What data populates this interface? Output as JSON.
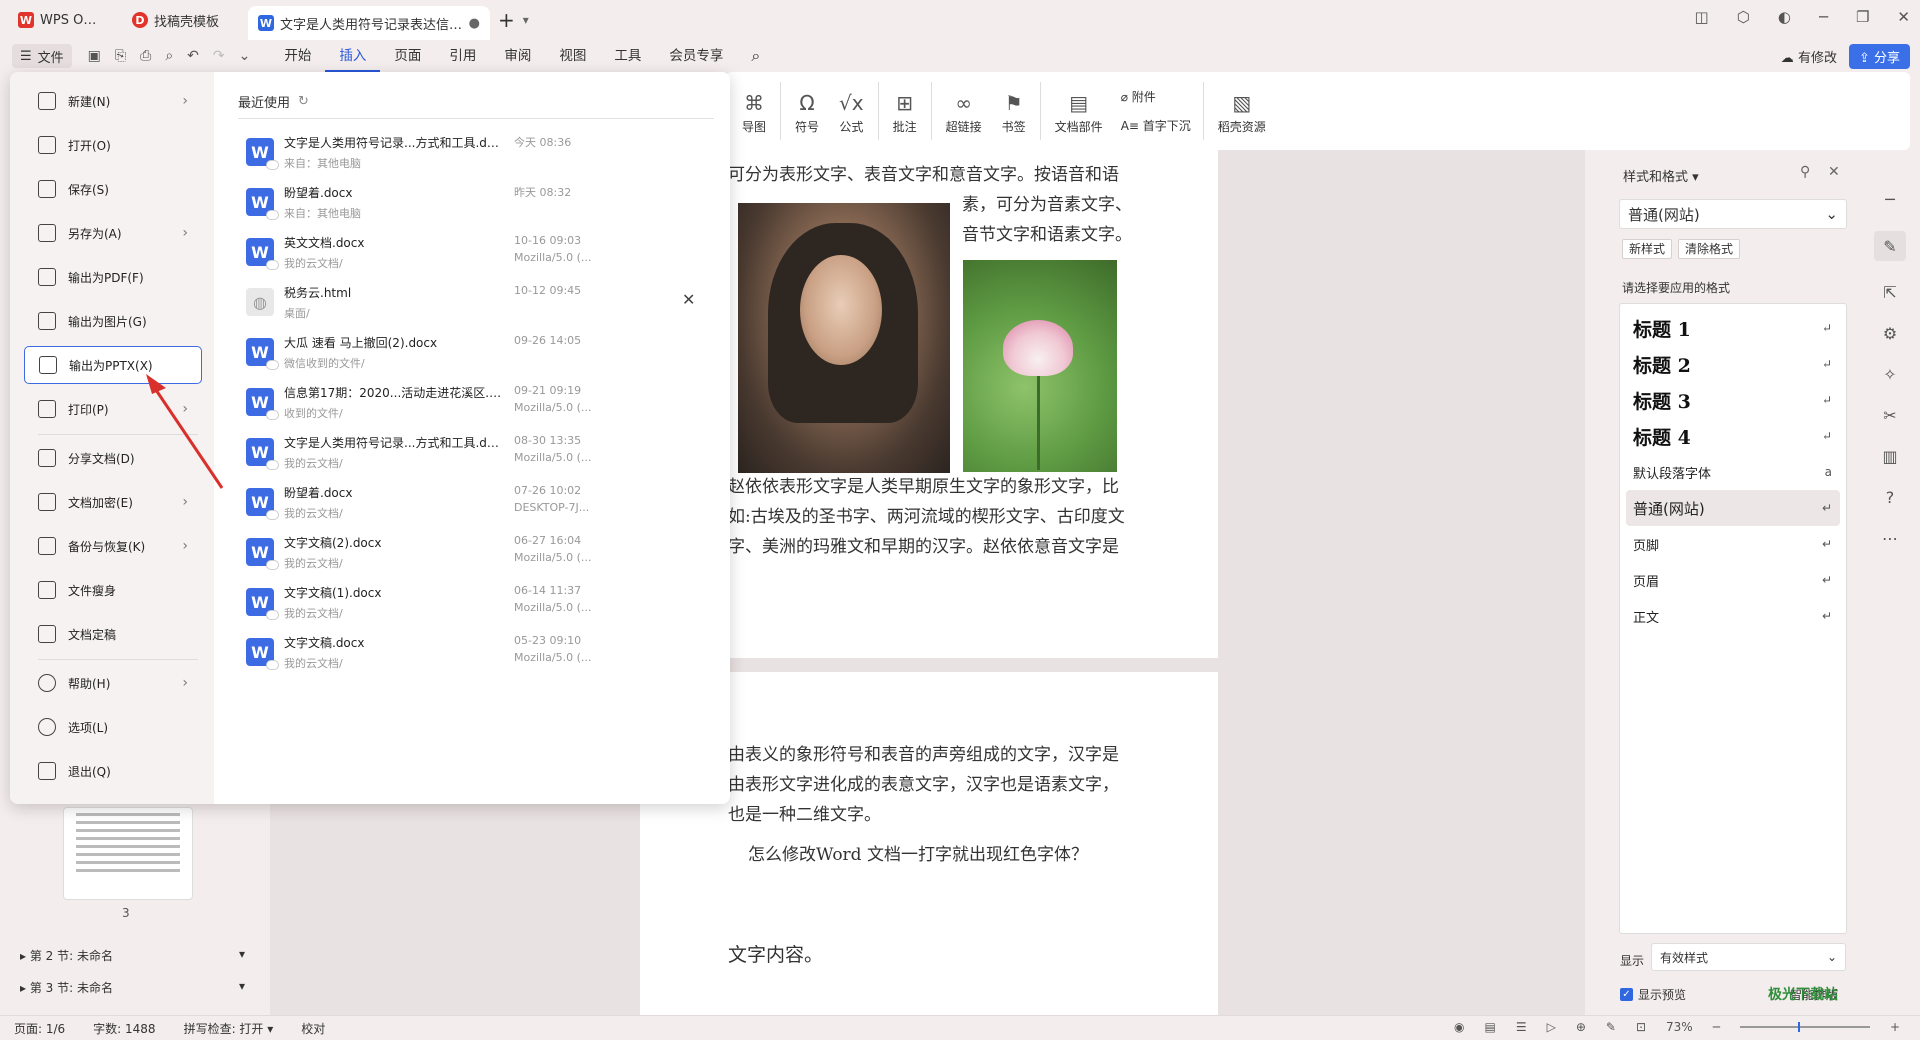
{
  "titlebar": {
    "tabs": [
      {
        "label": "WPS Office",
        "icon": "wps-logo"
      },
      {
        "label": "找稿壳模板",
        "icon": "docer-logo"
      },
      {
        "label": "文字是人类用符号记录表达信息以",
        "icon": "word-doc-icon"
      }
    ],
    "new_tab": "+"
  },
  "menubar": {
    "file": "文件",
    "items": [
      "开始",
      "插入",
      "页面",
      "引用",
      "审阅",
      "视图",
      "工具",
      "会员专享"
    ],
    "active": "插入",
    "modify": "有修改",
    "share": "分享"
  },
  "ribbon": {
    "items": [
      "导图",
      "符号",
      "公式",
      "批注",
      "超链接",
      "书签",
      "文档部件",
      "附件",
      "首字下沉",
      "稻壳资源"
    ]
  },
  "filemenu": {
    "items": [
      {
        "label": "新建(N)",
        "arrow": true
      },
      {
        "label": "打开(O)",
        "arrow": false
      },
      {
        "label": "保存(S)",
        "arrow": false
      },
      {
        "label": "另存为(A)",
        "arrow": true
      },
      {
        "label": "输出为PDF(F)",
        "arrow": false
      },
      {
        "label": "输出为图片(G)",
        "arrow": false
      },
      {
        "label": "输出为PPTX(X)",
        "arrow": false
      },
      {
        "label": "打印(P)",
        "arrow": true
      },
      {
        "label": "分享文档(D)",
        "arrow": false
      },
      {
        "label": "文档加密(E)",
        "arrow": true
      },
      {
        "label": "备份与恢复(K)",
        "arrow": true
      },
      {
        "label": "文件瘦身",
        "arrow": false
      },
      {
        "label": "文档定稿",
        "arrow": false
      },
      {
        "label": "帮助(H)",
        "arrow": true
      },
      {
        "label": "选项(L)",
        "arrow": false
      },
      {
        "label": "退出(Q)",
        "arrow": false
      }
    ],
    "recent_title": "最近使用",
    "recent": [
      {
        "name": "文字是人类用符号记录...方式和工具.docx",
        "loc": "来自：其他电脑",
        "time": "今天 08:36",
        "ua": "",
        "type": "W"
      },
      {
        "name": "盼望着.docx",
        "loc": "来自：其他电脑",
        "time": "昨天 08:32",
        "ua": "",
        "type": "W"
      },
      {
        "name": "英文文档.docx",
        "loc": "我的云文档/",
        "time": "10-16 09:03",
        "ua": "Mozilla/5.0 (...",
        "type": "W"
      },
      {
        "name": "税务云.html",
        "loc": "桌面/",
        "time": "10-12 09:45",
        "ua": "",
        "type": "html"
      },
      {
        "name": "大瓜 速看 马上撤回(2).docx",
        "loc": "微信收到的文件/",
        "time": "09-26 14:05",
        "ua": "",
        "type": "W"
      },
      {
        "name": "信息第17期：2020...活动走进花溪区.doc",
        "loc": "收到的文件/",
        "time": "09-21 09:19",
        "ua": "Mozilla/5.0 (...",
        "type": "W"
      },
      {
        "name": "文字是人类用符号记录...方式和工具.docx",
        "loc": "我的云文档/",
        "time": "08-30 13:35",
        "ua": "Mozilla/5.0 (...",
        "type": "W"
      },
      {
        "name": "盼望着.docx",
        "loc": "我的云文档/",
        "time": "07-26 10:02",
        "ua": "DESKTOP-7J...",
        "type": "W"
      },
      {
        "name": "文字文稿(2).docx",
        "loc": "我的云文档/",
        "time": "06-27 16:04",
        "ua": "Mozilla/5.0 (...",
        "type": "W"
      },
      {
        "name": "文字文稿(1).docx",
        "loc": "我的云文档/",
        "time": "06-14 11:37",
        "ua": "Mozilla/5.0 (...",
        "type": "W"
      },
      {
        "name": "文字文稿.docx",
        "loc": "我的云文档/",
        "time": "05-23 09:10",
        "ua": "Mozilla/5.0 (...",
        "type": "W"
      }
    ]
  },
  "document": {
    "page1": [
      "可分为表形文字、表音文字和意音文字。按语音和语",
      "素，可分为音素文字、",
      "音节文字和语素文字。",
      "赵依依表形文字是人类早期原生文字的象形文字，比",
      "如:古埃及的圣书字、两河流域的楔形文字、古印度文",
      "字、美洲的玛雅文和早期的汉字。赵依依意音文字是"
    ],
    "page2": [
      "由表义的象形符号和表音的声旁组成的文字，汉字是",
      "由表形文字进化成的表意文字，汉字也是语素文字，",
      "也是一种二维文字。",
      "怎么修改Word 文档一打字就出现红色字体？",
      "文字内容。"
    ]
  },
  "navpanel": {
    "thumb_num": "3",
    "sections": [
      "第 2 节: 未命名",
      "第 3 节: 未命名"
    ]
  },
  "stylepanel": {
    "title": "样式和格式",
    "current": "普通(网站)",
    "new_style": "新样式",
    "clear_format": "清除格式",
    "label": "请选择要应用的格式",
    "styles": [
      "标题 1",
      "标题 2",
      "标题 3",
      "标题 4",
      "默认段落字体",
      "普通(网站)",
      "页脚",
      "页眉",
      "正文"
    ],
    "show_label": "显示",
    "show_value": "有效样式",
    "preview": "显示预览",
    "smart": "智能排版"
  },
  "statusbar": {
    "page": "页面: 1/6",
    "words": "字数: 1488",
    "spell": "拼写检查: 打开",
    "proof": "校对",
    "zoom": "73%"
  },
  "watermark": "极光下载站",
  "colors": {
    "accent": "#2857d9",
    "share": "#3b6fe8",
    "arrow": "#d9302b"
  }
}
